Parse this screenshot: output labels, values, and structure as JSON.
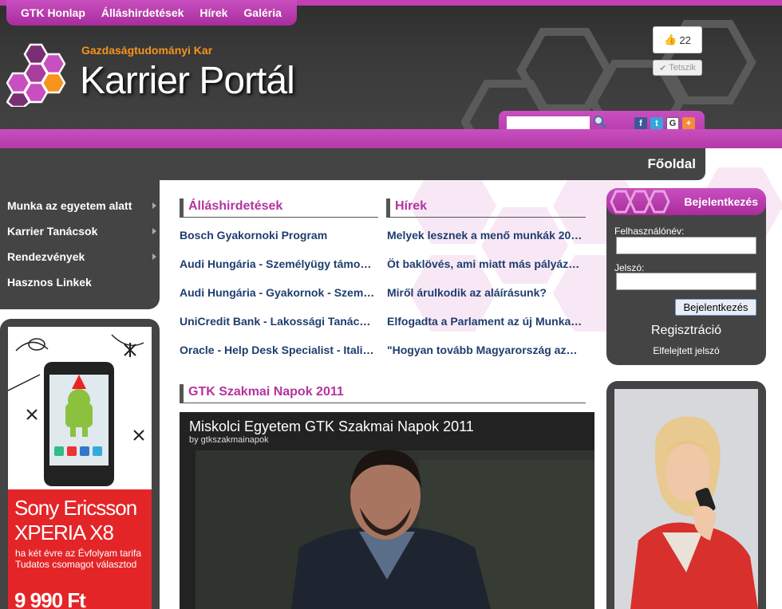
{
  "top_nav": {
    "items": [
      {
        "label": "GTK Honlap"
      },
      {
        "label": "Álláshirdetések"
      },
      {
        "label": "Hírek"
      },
      {
        "label": "Galéria"
      }
    ]
  },
  "brand": {
    "subtitle": "Gazdaságtudományi Kar",
    "title": "Karrier Portál"
  },
  "facebook": {
    "like_count": "22",
    "like_label": "Tetszik"
  },
  "search": {
    "value": ""
  },
  "social_icons": [
    "facebook-icon",
    "twitter-icon",
    "share-icon",
    "addthis-icon"
  ],
  "page": {
    "title": "Főoldal"
  },
  "left_menu": {
    "items": [
      {
        "label": "Munka az egyetem alatt",
        "has_submenu": true
      },
      {
        "label": "Karrier Tanácsok",
        "has_submenu": true
      },
      {
        "label": "Rendezvények",
        "has_submenu": true
      },
      {
        "label": "Hasznos Linkek",
        "has_submenu": false
      }
    ]
  },
  "left_ad": {
    "brand": "Sony Ericsson",
    "model_line1": "Sony Ericsson",
    "model_line2": "XPERIA X8",
    "text": "ha két évre az Évfolyam tarifa Tudatos csomagot választod",
    "price": "9 990 Ft"
  },
  "jobs": {
    "heading": "Álláshirdetések",
    "items": [
      "Bosch Gyakornoki Program",
      "Audi Hungária - Személyügy támo…",
      "Audi Hungária - Gyakornok - Szem…",
      "UniCredit Bank - Lakossági Tanác…",
      "Oracle - Help Desk Specialist - Itali…"
    ]
  },
  "news": {
    "heading": "Hírek",
    "items": [
      "Melyek lesznek a menő munkák 20…",
      "Öt baklövés, ami miatt más pályáz…",
      "Miről árulkodik az aláírásunk?",
      "Elfogadta a Parlament az új Munka…",
      "\"Hogyan tovább Magyarország az…"
    ]
  },
  "video_section": {
    "heading": "GTK Szakmai Napok 2011",
    "video_title": "Miskolci Egyetem GTK Szakmai Napok 2011",
    "video_by": "by gtkszakmainapok"
  },
  "login": {
    "title": "Bejelentkezés",
    "username_label": "Felhasználónév:",
    "username_value": "",
    "password_label": "Jelszó:",
    "password_value": "",
    "submit_label": "Bejelentkezés",
    "register_label": "Regisztráció",
    "forgot_label": "Elfelejtett jelszó"
  },
  "colors": {
    "accent": "#b5339f",
    "dark": "#444444",
    "link": "#1f3d6e",
    "logo_orange": "#f7941d"
  }
}
